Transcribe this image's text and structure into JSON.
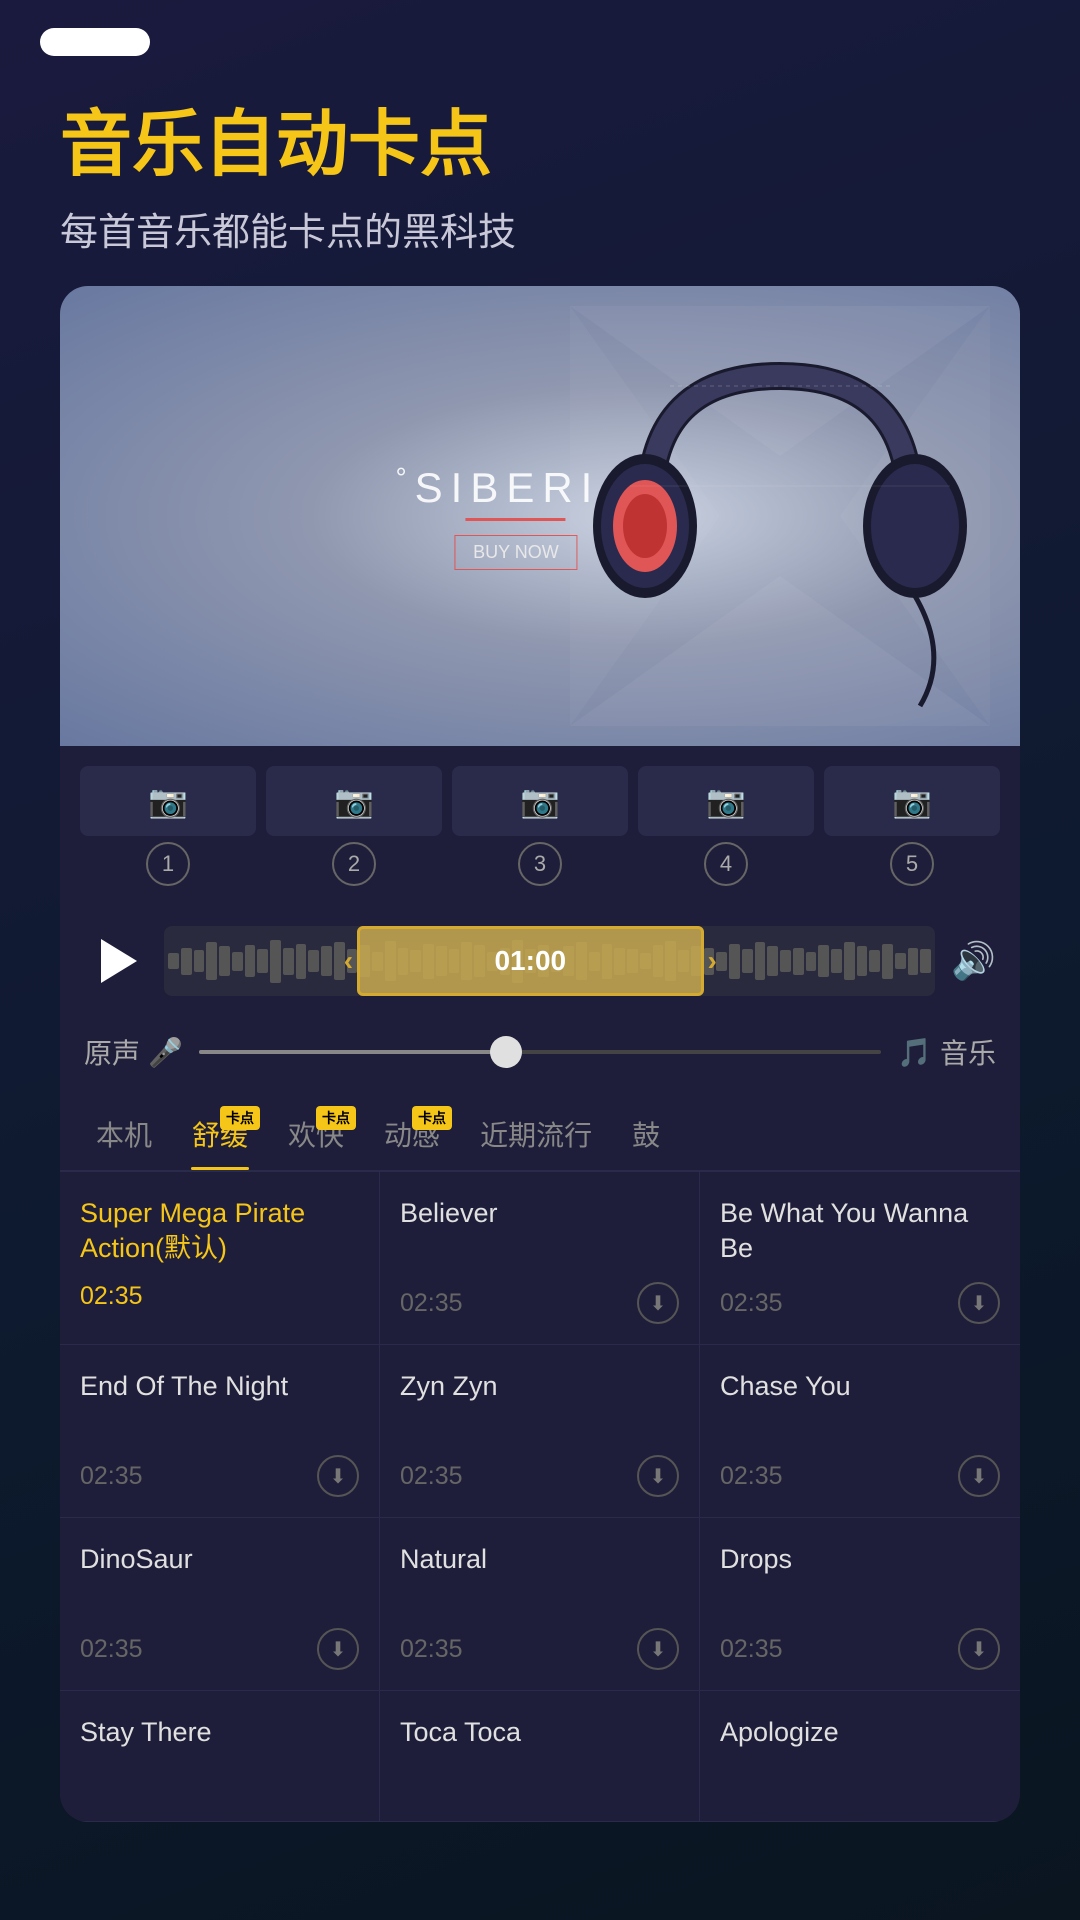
{
  "statusBar": {
    "pill": ""
  },
  "header": {
    "title": "音乐自动卡点",
    "subtitle": "每首音乐都能卡点的黑科技"
  },
  "heroBrand": {
    "prefix": "°",
    "name": "SIBERIA",
    "buyNow": "BUY NOW"
  },
  "thumbnails": [
    {
      "num": "1"
    },
    {
      "num": "2"
    },
    {
      "num": "3"
    },
    {
      "num": "4"
    },
    {
      "num": "5"
    }
  ],
  "player": {
    "time": "01:00",
    "playLabel": "play"
  },
  "mixSlider": {
    "leftLabel": "原声",
    "rightLabel": "音乐"
  },
  "tabs": [
    {
      "label": "本机",
      "active": false,
      "badge": false
    },
    {
      "label": "舒缓",
      "active": true,
      "badge": true
    },
    {
      "label": "欢快",
      "active": false,
      "badge": true
    },
    {
      "label": "动感",
      "active": false,
      "badge": true
    },
    {
      "label": "近期流行",
      "active": false,
      "badge": false
    },
    {
      "label": "鼓",
      "active": false,
      "badge": false
    }
  ],
  "musicList": [
    {
      "name": "Super Mega Pirate Action(默认)",
      "duration": "02:35",
      "active": true,
      "hasDownload": false
    },
    {
      "name": "Believer",
      "duration": "02:35",
      "active": false,
      "hasDownload": true
    },
    {
      "name": "Be What You Wanna Be",
      "duration": "02:35",
      "active": false,
      "hasDownload": true
    },
    {
      "name": "End Of The Night",
      "duration": "02:35",
      "active": false,
      "hasDownload": true
    },
    {
      "name": "Zyn Zyn",
      "duration": "02:35",
      "active": false,
      "hasDownload": true
    },
    {
      "name": "Chase You",
      "duration": "02:35",
      "active": false,
      "hasDownload": true
    },
    {
      "name": "DinoSaur",
      "duration": "02:35",
      "active": false,
      "hasDownload": true
    },
    {
      "name": "Natural",
      "duration": "02:35",
      "active": false,
      "hasDownload": true
    },
    {
      "name": "Drops",
      "duration": "02:35",
      "active": false,
      "hasDownload": true
    },
    {
      "name": "Stay There",
      "duration": "",
      "active": false,
      "hasDownload": false
    },
    {
      "name": "Toca Toca",
      "duration": "",
      "active": false,
      "hasDownload": false
    },
    {
      "name": "Apologize",
      "duration": "",
      "active": false,
      "hasDownload": false
    }
  ]
}
